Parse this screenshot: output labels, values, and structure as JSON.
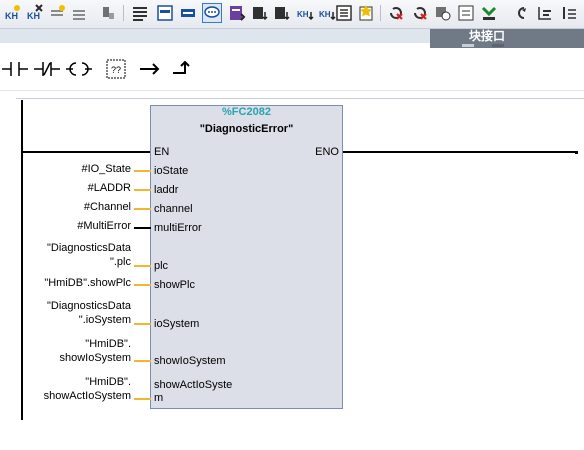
{
  "toolbar": {
    "icons": [
      "insert-network-icon",
      "delete-network-icon",
      "insert-row-icon",
      "add-row-icon",
      "step-icon",
      "absolute-view-icon",
      "symbolic-view-icon",
      "symbol-info-icon",
      "comment-icon",
      "favorites-icon",
      "expand-icon",
      "collapse-icon",
      "open-all-icon",
      "close-all-icon",
      "go-to-icon",
      "monitor-icon",
      "reset-icon",
      "modify-icon",
      "display-icon",
      "watch-icon",
      "download-icon",
      "undo-icon",
      "list-icon",
      "tree-icon",
      "up-icon"
    ]
  },
  "interface_panel": {
    "label": "块接口"
  },
  "palette": {
    "items": [
      "normally-open-contact",
      "normally-closed-contact",
      "output-coil",
      "empty-box",
      "open-branch",
      "close-branch"
    ],
    "empty_box_label": "??"
  },
  "block": {
    "instance": "%FC2082",
    "name": "\"DiagnosticError\"",
    "inputs": [
      {
        "pin": "EN",
        "argument_lines": []
      },
      {
        "pin": "ioState",
        "argument_lines": [
          "#IO_State"
        ]
      },
      {
        "pin": "laddr",
        "argument_lines": [
          "#LADDR"
        ]
      },
      {
        "pin": "channel",
        "argument_lines": [
          "#Channel"
        ]
      },
      {
        "pin": "multiError",
        "argument_lines": [
          "#MultiError"
        ]
      },
      {
        "pin": "plc",
        "argument_lines": [
          "\"DiagnosticsData",
          "\".plc"
        ]
      },
      {
        "pin": "showPlc",
        "argument_lines": [
          "\"HmiDB\".showPlc"
        ]
      },
      {
        "pin": "ioSystem",
        "argument_lines": [
          "\"DiagnosticsData",
          "\".ioSystem"
        ]
      },
      {
        "pin": "showIoSystem",
        "argument_lines": [
          "\"HmiDB\".",
          "showIoSystem"
        ]
      },
      {
        "pin_lines": [
          "showActIoSyste",
          "m"
        ],
        "argument_lines": [
          "\"HmiDB\".",
          "showActIoSystem"
        ]
      }
    ],
    "outputs": [
      {
        "pin": "ENO"
      }
    ]
  }
}
